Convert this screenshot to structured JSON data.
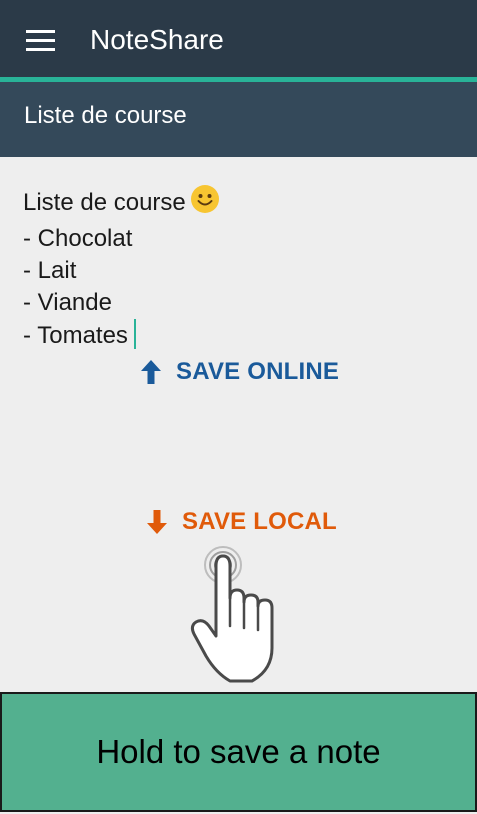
{
  "app": {
    "title": "NoteShare"
  },
  "note": {
    "title": "Liste de course",
    "lines": [
      "Liste de course",
      "- Chocolat",
      "- Lait",
      "- Viande",
      "- Tomates"
    ],
    "emoji": "smiley-icon"
  },
  "actions": {
    "save_online": "SAVE ONLINE",
    "save_local": "SAVE LOCAL"
  },
  "hint": {
    "text": "Hold to save a note"
  },
  "colors": {
    "appbar": "#2b3a48",
    "accent": "#29b398",
    "subbar": "#34495a",
    "online": "#1a5a9a",
    "local": "#e05a0a",
    "hint_bg": "#53b08f"
  },
  "icons": {
    "menu": "hamburger-menu-icon",
    "online": "arrow-up-icon",
    "local": "arrow-down-icon",
    "gesture": "tap-hand-icon"
  }
}
